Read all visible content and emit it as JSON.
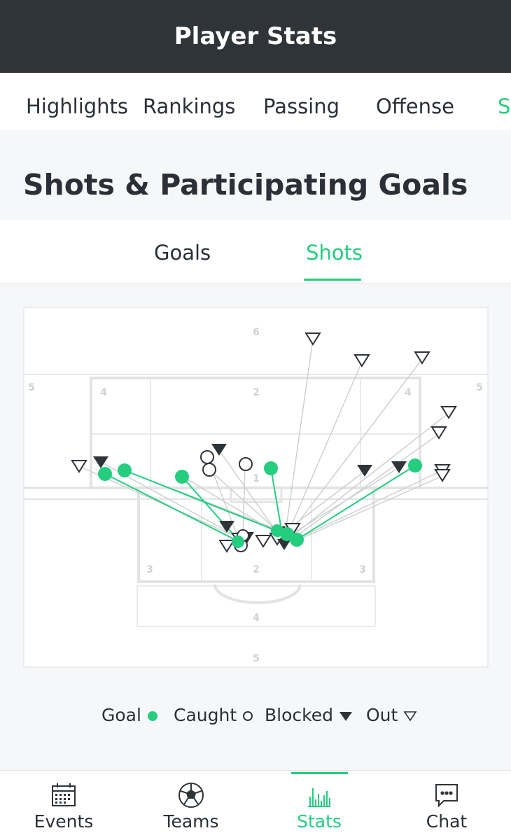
{
  "header": {
    "title": "Player Stats"
  },
  "tabs": [
    {
      "label": "Highlights",
      "active": false
    },
    {
      "label": "Rankings",
      "active": false
    },
    {
      "label": "Passing",
      "active": false
    },
    {
      "label": "Offense",
      "active": false
    },
    {
      "label": "S",
      "active": true
    }
  ],
  "section": {
    "title": "Shots & Participating Goals"
  },
  "subtabs": [
    {
      "label": "Goals",
      "active": false
    },
    {
      "label": "Shots",
      "active": true
    }
  ],
  "court": {
    "zone_labels": [
      "6",
      "5",
      "4",
      "2",
      "4",
      "5",
      "1",
      "3",
      "2",
      "3",
      "4",
      "5"
    ]
  },
  "legend": [
    {
      "label": "Goal",
      "symbol": "goal"
    },
    {
      "label": "Caught",
      "symbol": "caught"
    },
    {
      "label": "Blocked",
      "symbol": "blocked"
    },
    {
      "label": "Out",
      "symbol": "out"
    }
  ],
  "colors": {
    "accent": "#25cd7f",
    "dark": "#2f3439"
  },
  "bottom_nav": [
    {
      "label": "Events",
      "icon": "calendar-icon",
      "active": false
    },
    {
      "label": "Teams",
      "icon": "soccer-ball-icon",
      "active": false
    },
    {
      "label": "Stats",
      "icon": "bar-chart-icon",
      "active": true
    },
    {
      "label": "Chat",
      "icon": "chat-bubble-icon",
      "active": false
    }
  ]
}
